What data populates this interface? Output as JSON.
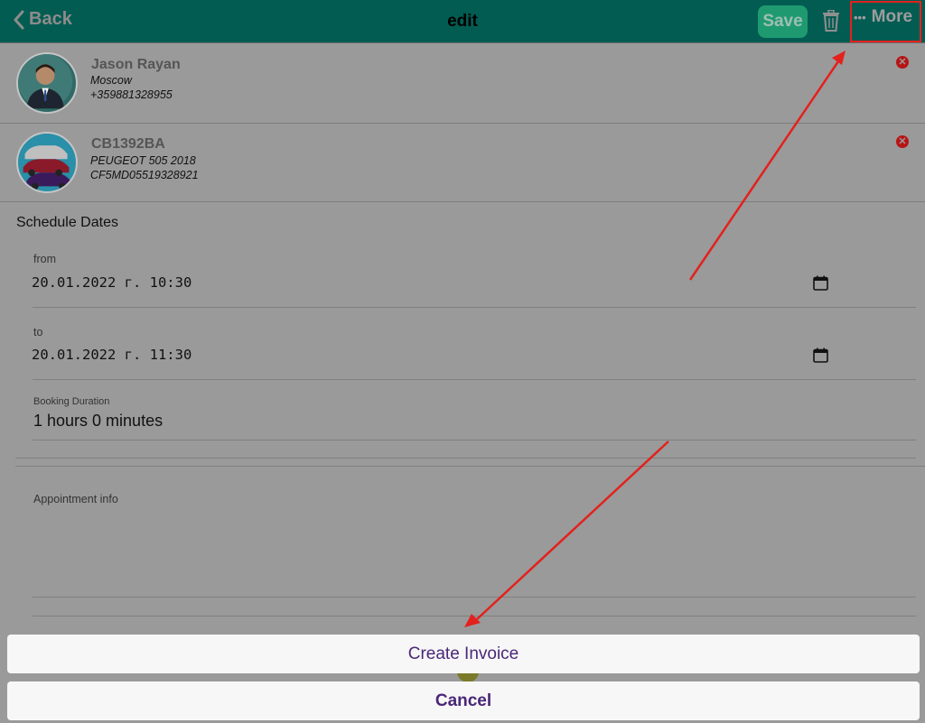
{
  "header": {
    "back_label": "Back",
    "title": "edit",
    "save_label": "Save",
    "more_label": "More",
    "more_dots": "•••"
  },
  "client": {
    "name": "Jason Rayan",
    "city": "Moscow",
    "phone": "+359881328955"
  },
  "vehicle": {
    "plate": "CB1392BA",
    "model": "PEUGEOT 505 2018",
    "vin": "CF5MD05519328921"
  },
  "schedule": {
    "section_title": "Schedule Dates",
    "from_label": "from",
    "from_value": "20.01.2022 г. 10:30",
    "to_label": "to",
    "to_value": "20.01.2022 г. 11:30",
    "duration_label": "Booking Duration",
    "duration_value": "1 hours 0 minutes"
  },
  "appointment": {
    "info_label": "Appointment info"
  },
  "action_sheet": {
    "create_invoice": "Create Invoice",
    "cancel": "Cancel"
  },
  "colors": {
    "header_bg": "#025c52",
    "save_bg": "#1f9a70",
    "highlight": "#e3211d",
    "sheet_text": "#4a2777",
    "remove_icon": "#b81414"
  },
  "icons": {
    "back": "chevron-left-icon",
    "delete": "trash-icon",
    "more": "ellipsis-icon",
    "remove": "close-circle-icon",
    "date": "calendar-icon"
  }
}
